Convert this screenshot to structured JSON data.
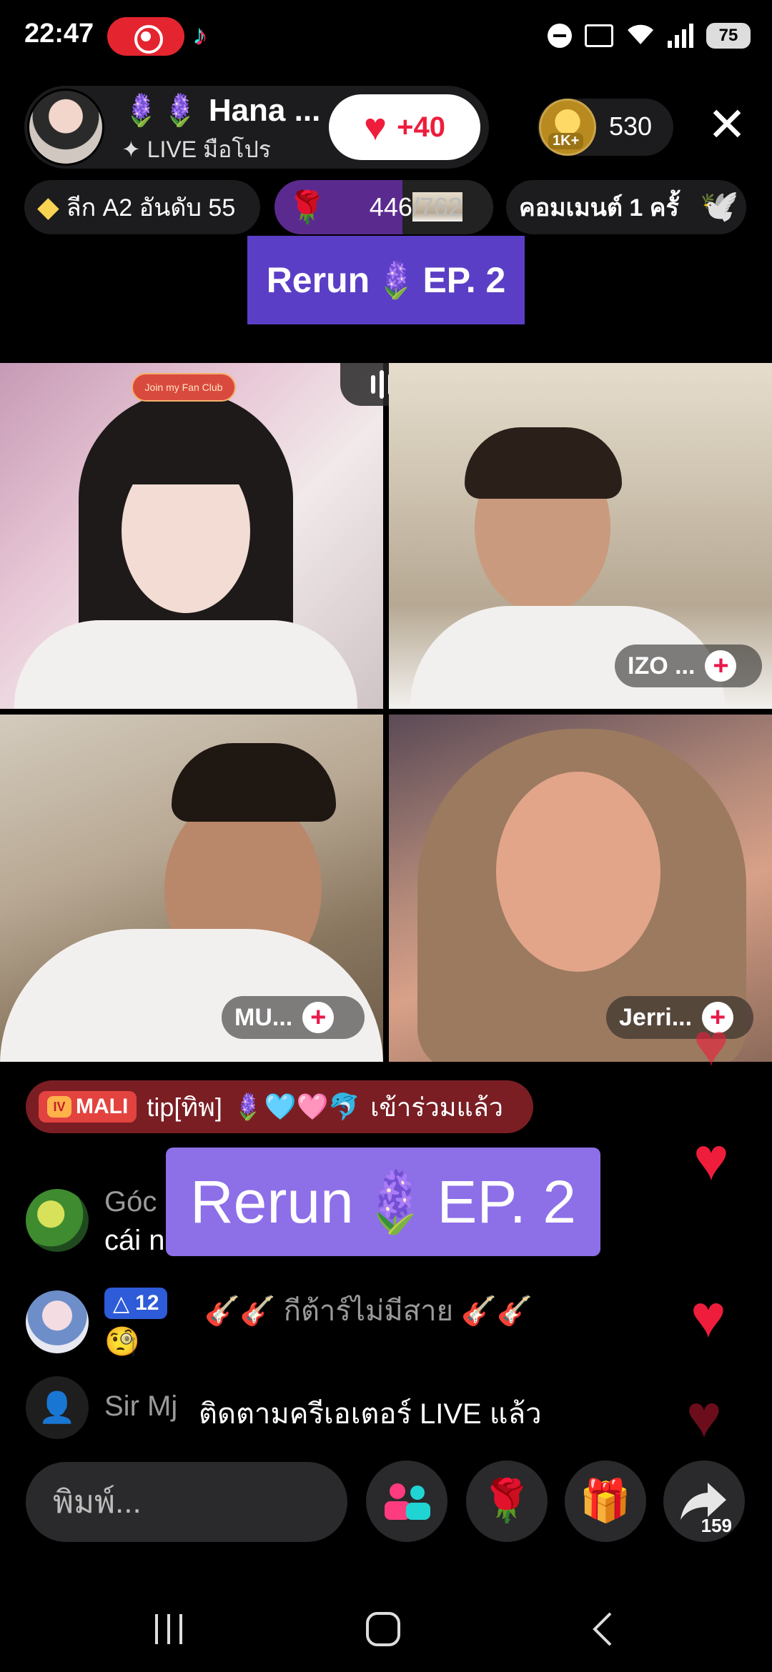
{
  "status_bar": {
    "time": "22:47",
    "battery": "75",
    "icons": [
      "screen-record-icon",
      "tiktok-icon",
      "do-not-disturb-icon",
      "cast-icon",
      "wifi-icon",
      "signal-icon",
      "battery-icon"
    ]
  },
  "host": {
    "name": "Hana ...",
    "subtitle": "LIVE มือโปร",
    "likes": "+40"
  },
  "viewers": {
    "badge": "1K+",
    "count": "530"
  },
  "chips": {
    "league": "ลีก A2 อันดับ 55",
    "rose_current": "446",
    "rose_goal": "/762",
    "rose_progress": 0.585,
    "comment": "คอมเมนต์ 1 ครั้"
  },
  "rerun_top": {
    "prefix": "Rerun",
    "suffix": "EP. 2"
  },
  "guests": {
    "host_tile": {
      "fan_club": "Join my Fan Club"
    },
    "guest2": "IZO ...",
    "guest3": "MU...",
    "guest4": "Jerri..."
  },
  "join_banner": {
    "badge": "MALI",
    "badge_icon": "IV",
    "text": "tip[ทิพ]",
    "emojis": "🪻🩵🩷🐬",
    "action": "เข้าร่วมแล้ว"
  },
  "chat": [
    {
      "name": "Góc",
      "message": "cái n"
    },
    {
      "level": "12",
      "message": "🎸🎸 กีต้าร์ไม่มีสาย 🎸🎸",
      "message2": "🧐"
    },
    {
      "name": "Sir Mj",
      "message": "ติดตามครีเอเตอร์ LIVE แล้ว"
    }
  ],
  "rerun_overlay": {
    "prefix": "Rerun",
    "suffix": "EP. 2"
  },
  "bottom_bar": {
    "placeholder": "พิมพ์...",
    "share_count": "159"
  },
  "colors": {
    "accent_red": "#ee1d3c",
    "rerun_purple": "#5b3ec6",
    "rerun_light": "#8d6fe8",
    "rose_progress": "#5b2a8f"
  }
}
